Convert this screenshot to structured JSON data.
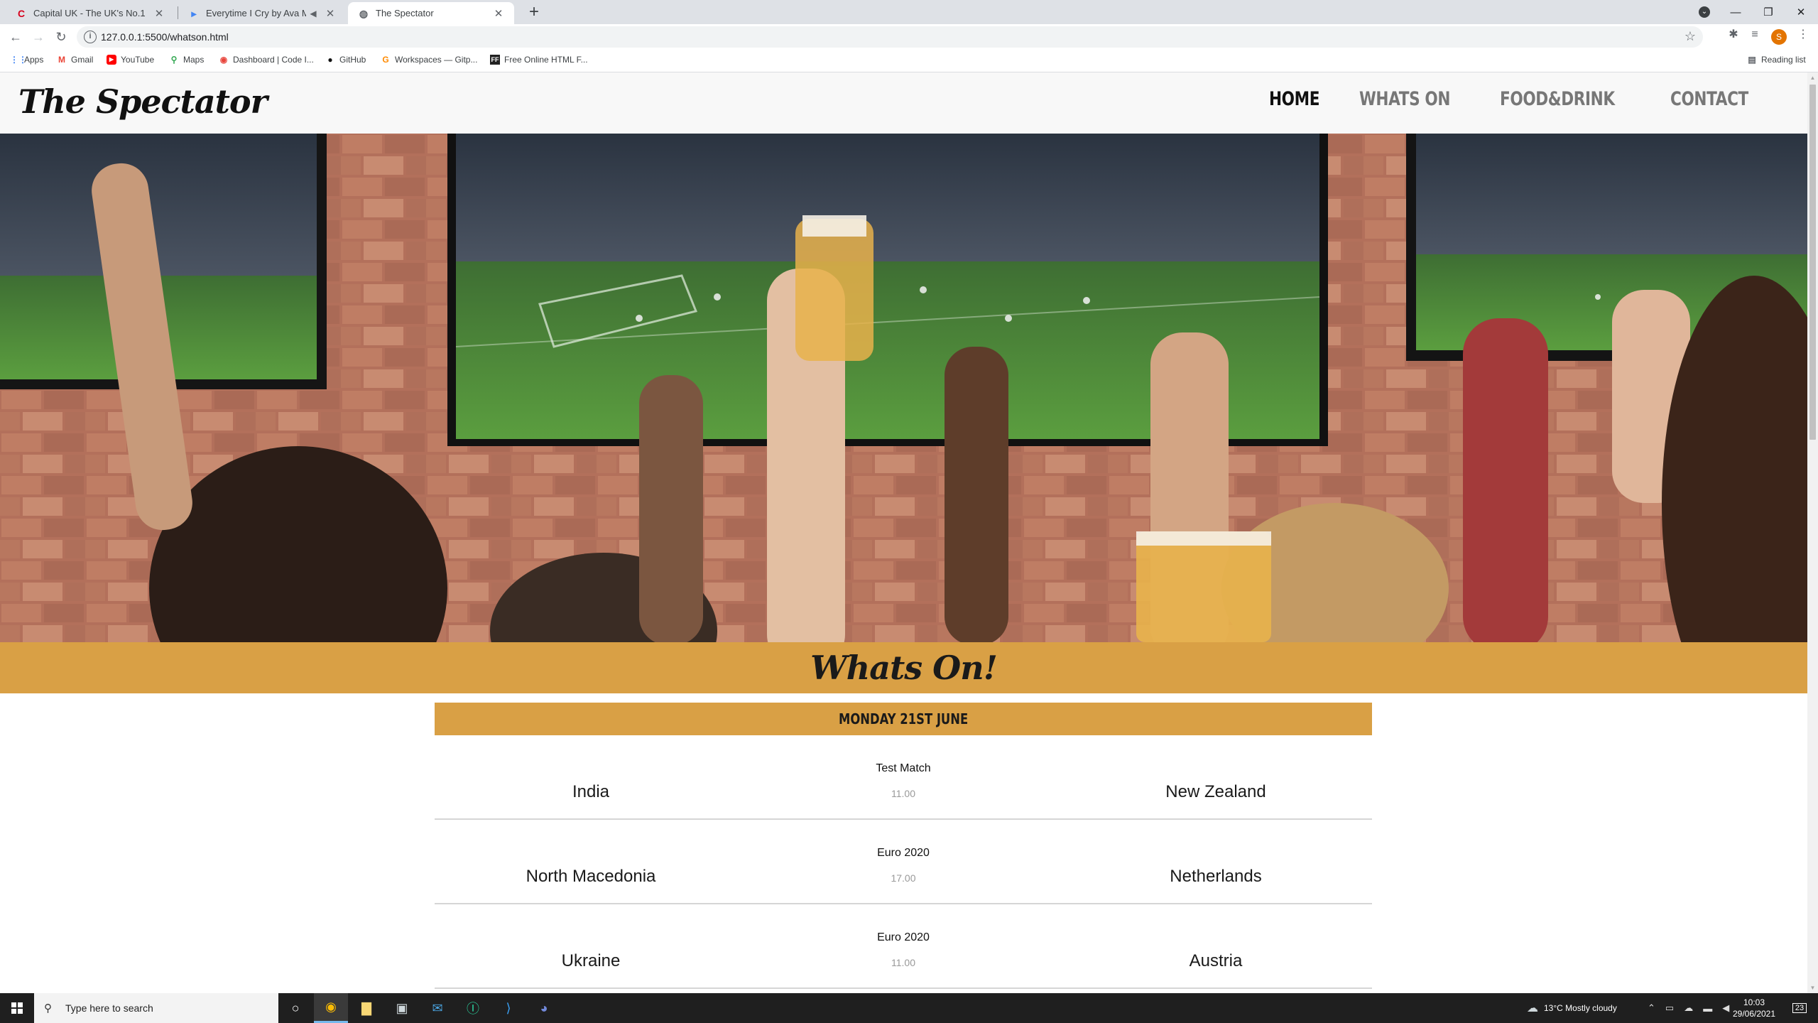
{
  "browser": {
    "tabs": [
      {
        "title": "Capital UK - The UK's No.1 Hit M",
        "favicon": "capital-c-icon"
      },
      {
        "title": "Everytime I Cry by Ava Max |",
        "favicon": "play-icon"
      },
      {
        "title": "The Spectator",
        "favicon": "globe-icon",
        "active": true
      }
    ],
    "url": "127.0.0.1:5500/whatson.html",
    "profile_initial": "S",
    "bookmarks": [
      "Apps",
      "Gmail",
      "YouTube",
      "Maps",
      "Dashboard | Code I...",
      "GitHub",
      "Workspaces — Gitp...",
      "Free Online HTML F..."
    ],
    "reading_list": "Reading list"
  },
  "site": {
    "logo": "The Spectator",
    "nav": [
      "HOME",
      "WHATS ON",
      "FOOD&DRINK",
      "CONTACT"
    ],
    "banner_title": "Whats On!",
    "day": "MONDAY 21ST JUNE",
    "matches": [
      {
        "competition": "Test Match",
        "home": "India",
        "time": "11.00",
        "away": "New Zealand"
      },
      {
        "competition": "Euro 2020",
        "home": "North Macedonia",
        "time": "17.00",
        "away": "Netherlands"
      },
      {
        "competition": "Euro 2020",
        "home": "Ukraine",
        "time": "11.00",
        "away": "Austria"
      }
    ],
    "accent_color": "#d9a045"
  },
  "taskbar": {
    "search_placeholder": "Type here to search",
    "weather": "13°C  Mostly cloudy",
    "time": "10:03",
    "date": "29/06/2021",
    "notification_count": "23"
  }
}
